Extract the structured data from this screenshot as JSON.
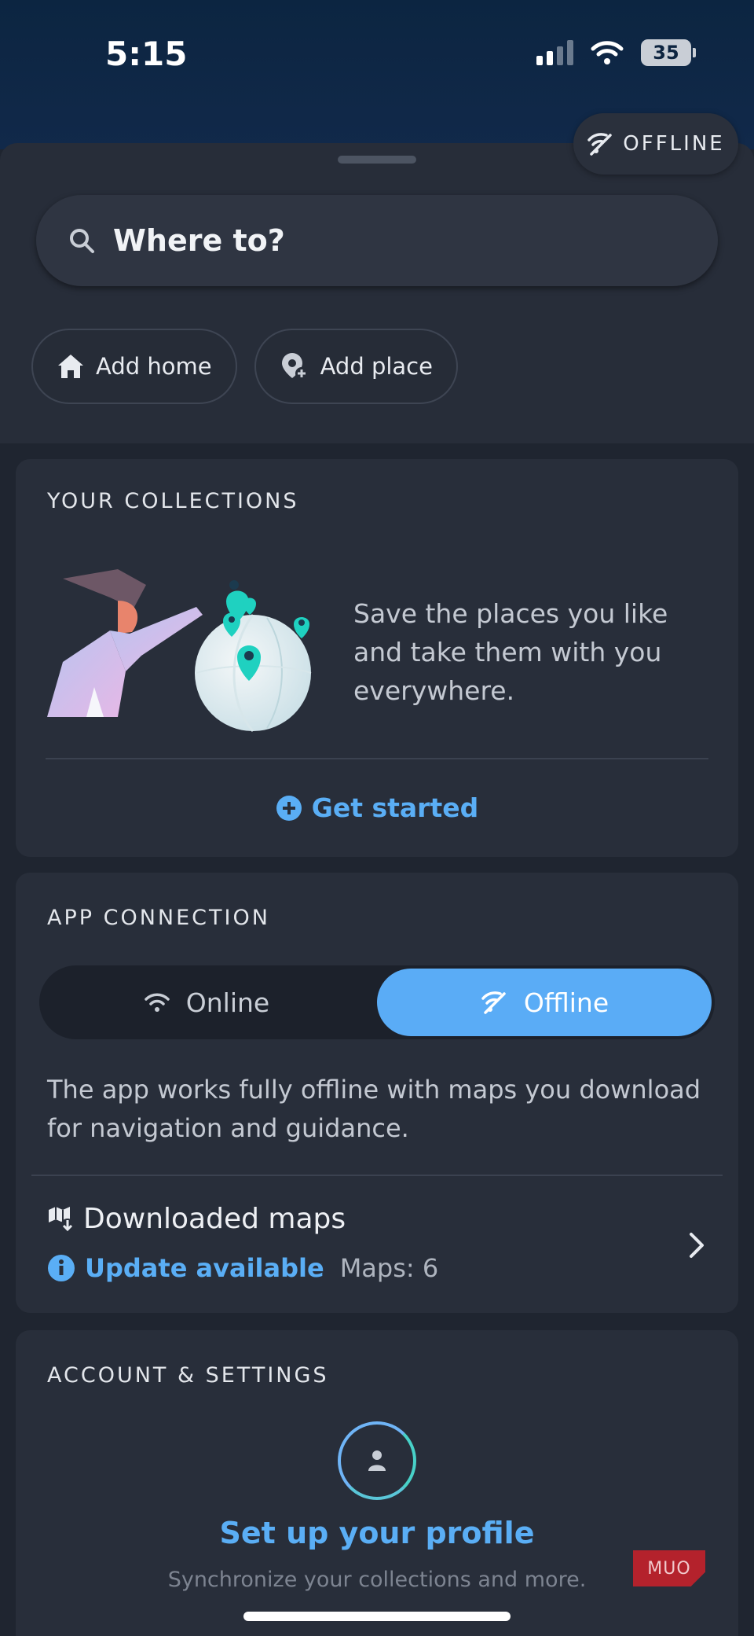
{
  "status_bar": {
    "time": "5:15",
    "battery": "35"
  },
  "offline_badge": {
    "label": "OFFLINE"
  },
  "search": {
    "placeholder": "Where to?"
  },
  "shortcuts": {
    "add_home": "Add home",
    "add_place": "Add place"
  },
  "collections": {
    "title": "YOUR COLLECTIONS",
    "description": "Save the places you like and take them with you everywhere.",
    "cta": "Get started"
  },
  "connection": {
    "title": "APP CONNECTION",
    "options": [
      "Online",
      "Offline"
    ],
    "selected": "Offline",
    "description": "The app works fully offline with maps you download for navigation and guidance.",
    "downloaded_maps": {
      "title": "Downloaded maps",
      "status": "Update available",
      "count": "Maps: 6"
    }
  },
  "account": {
    "title": "ACCOUNT & SETTINGS",
    "profile_cta": "Set up your profile",
    "profile_sub": "Synchronize your collections and more."
  },
  "watermark": "MUO",
  "colors": {
    "accent": "#5aacf6",
    "teal": "#1fd1c0",
    "card": "#282e3a",
    "background": "#1f2530"
  }
}
